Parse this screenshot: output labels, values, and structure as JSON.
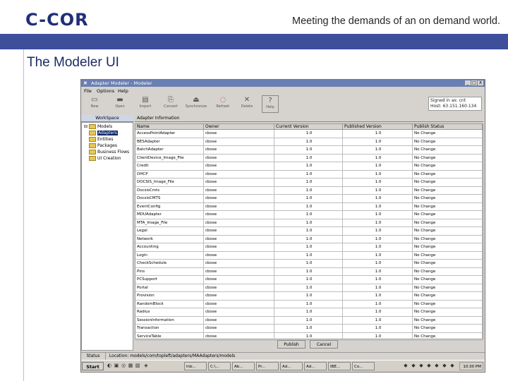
{
  "slide": {
    "logo": "C-COR",
    "tagline": "Meeting the demands of an on demand world.",
    "title": "The Modeler UI"
  },
  "window": {
    "title": "Adapter Modeler - Modeler",
    "controls": [
      "_",
      "□",
      "X"
    ]
  },
  "menu": [
    "File",
    "Options",
    "Help"
  ],
  "toolbar": [
    {
      "label": "New",
      "icon": "new-file-icon"
    },
    {
      "label": "Open",
      "icon": "open-folder-icon"
    },
    {
      "label": "Import",
      "icon": "import-icon"
    },
    {
      "label": "Convert",
      "icon": "convert-icon"
    },
    {
      "label": "Synchronize",
      "icon": "synchronize-icon"
    },
    {
      "label": "Refresh",
      "icon": "refresh-icon"
    },
    {
      "label": "Delete",
      "icon": "delete-icon"
    },
    {
      "label": "Help",
      "icon": "help-icon"
    }
  ],
  "signin": {
    "line1": "Signed in as: cnt",
    "line2": "Host: 63.151.160.134"
  },
  "workspace": {
    "tab": "WorkSpace",
    "root": "Models",
    "items": [
      "Adapters",
      "Entities",
      "Packages",
      "Business Flows",
      "UI Creation"
    ]
  },
  "adapter_panel": {
    "tab": "Adapter Information",
    "columns": [
      "Name",
      "Owner",
      "Current Version",
      "Published Version",
      "Publish Status"
    ],
    "rows": [
      [
        "AccessPointAdapter",
        "cbose",
        "1.0",
        "1.0",
        "No Change"
      ],
      [
        "BESAdapter",
        "cbose",
        "1.0",
        "1.0",
        "No Change"
      ],
      [
        "BatchAdapter",
        "cbose",
        "1.0",
        "1.0",
        "No Change"
      ],
      [
        "ClientDevice_Image_File",
        "cbose",
        "1.0",
        "1.0",
        "No Change"
      ],
      [
        "Credit",
        "cbose",
        "1.0",
        "1.0",
        "No Change"
      ],
      [
        "DHCP",
        "cbose",
        "1.0",
        "1.0",
        "No Change"
      ],
      [
        "DOCSIS_Image_File",
        "cbose",
        "1.0",
        "1.0",
        "No Change"
      ],
      [
        "DocsisCmts",
        "cbose",
        "1.0",
        "1.0",
        "No Change"
      ],
      [
        "DocsisCMTS",
        "cbose",
        "1.0",
        "1.0",
        "No Change"
      ],
      [
        "EventConfig",
        "cbose",
        "1.0",
        "1.0",
        "No Change"
      ],
      [
        "MDUAdapter",
        "cbose",
        "1.0",
        "1.0",
        "No Change"
      ],
      [
        "MTA_Image_File",
        "cbose",
        "1.0",
        "1.0",
        "No Change"
      ],
      [
        "Legal",
        "cbose",
        "1.0",
        "1.0",
        "No Change"
      ],
      [
        "Network",
        "cbose",
        "1.0",
        "1.0",
        "No Change"
      ],
      [
        "Accounting",
        "cbose",
        "1.0",
        "1.0",
        "No Change"
      ],
      [
        "Login",
        "cbose",
        "1.0",
        "1.0",
        "No Change"
      ],
      [
        "CheckSchedule",
        "cbose",
        "1.0",
        "1.0",
        "No Change"
      ],
      [
        "Pins",
        "cbose",
        "1.0",
        "1.0",
        "No Change"
      ],
      [
        "PCSupport",
        "cbose",
        "1.0",
        "1.0",
        "No Change"
      ],
      [
        "Portal",
        "cbose",
        "1.0",
        "1.0",
        "No Change"
      ],
      [
        "Provision",
        "cbose",
        "1.0",
        "1.0",
        "No Change"
      ],
      [
        "RandomBlock",
        "cbose",
        "1.0",
        "1.0",
        "No Change"
      ],
      [
        "Radius",
        "cbose",
        "1.0",
        "1.0",
        "No Change"
      ],
      [
        "SessionInformation",
        "cbose",
        "1.0",
        "1.0",
        "No Change"
      ],
      [
        "Transaction",
        "cbose",
        "1.0",
        "1.0",
        "No Change"
      ],
      [
        "ServiceTable",
        "cbose",
        "1.0",
        "1.0",
        "No Change"
      ]
    ],
    "publish_button": "Publish",
    "cancel_button": "Cancel"
  },
  "statusbar": {
    "tab": "Status",
    "text": "Location: models/com/topleft/adapters/MAAdapters/models"
  },
  "taskbar": {
    "start": "Start",
    "tasks": [
      "Inb...",
      "C:\\...",
      "Ab...",
      "Pr...",
      "Ad...",
      "Ad...",
      "IBE...",
      "Co..."
    ],
    "clock": "10:30 PM"
  }
}
